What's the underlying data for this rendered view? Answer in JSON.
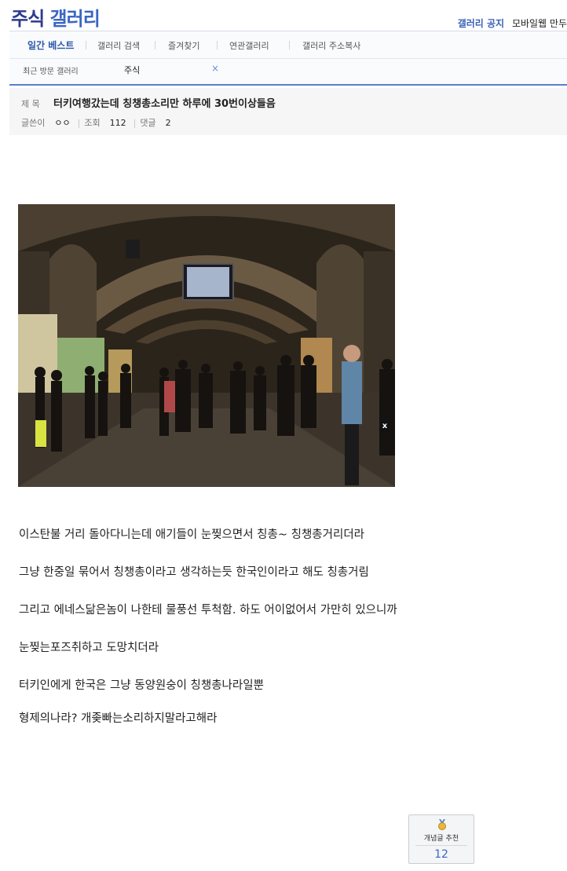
{
  "gallery": {
    "name": "주식",
    "suffix": "갤러리"
  },
  "top_links": {
    "notice": "갤러리 공지",
    "mobile": "모바일웹 만두"
  },
  "tabs": [
    "일간 베스트",
    "갤러리 검색",
    "즐겨찾기",
    "연관갤러리",
    "갤러리 주소복사"
  ],
  "recent": {
    "label": "최근 방문 갤러리",
    "item": "주식",
    "close": "×"
  },
  "post": {
    "subject_label": "제 목",
    "subject": "터키여행갔는데 칭챙총소리만 하루에 30번이상들음",
    "writer_label": "글쓴이",
    "writer": "ㅇㅇ",
    "views_label": "조회",
    "views": "112",
    "comments_label": "댓글",
    "comments": "2"
  },
  "image": {
    "close": "x"
  },
  "body_lines": [
    "이스탄불 거리 돌아다니는데 애기들이 눈찢으면서 칭총~ 칭챙총거리더라",
    "그냥 한중일 묶어서 칭챙총이라고 생각하는듯 한국인이라고 해도 칭총거림",
    "그리고 에네스닮은놈이 나한테 물풍선 투척함. 하도 어이없어서 가만히 있으니까",
    "눈찢는포즈취하고 도망치더라",
    "터키인에게 한국은 그냥 동양원숭이 칭챙총나라일뿐",
    "형제의나라? 개좆빠는소리하지말라고해라"
  ],
  "recommend": {
    "label": "개념글 추천",
    "count": "12"
  },
  "colors": {
    "accent": "#3a66c4",
    "brand": "#2f3a8b",
    "nav_border": "#5b7fc9"
  }
}
